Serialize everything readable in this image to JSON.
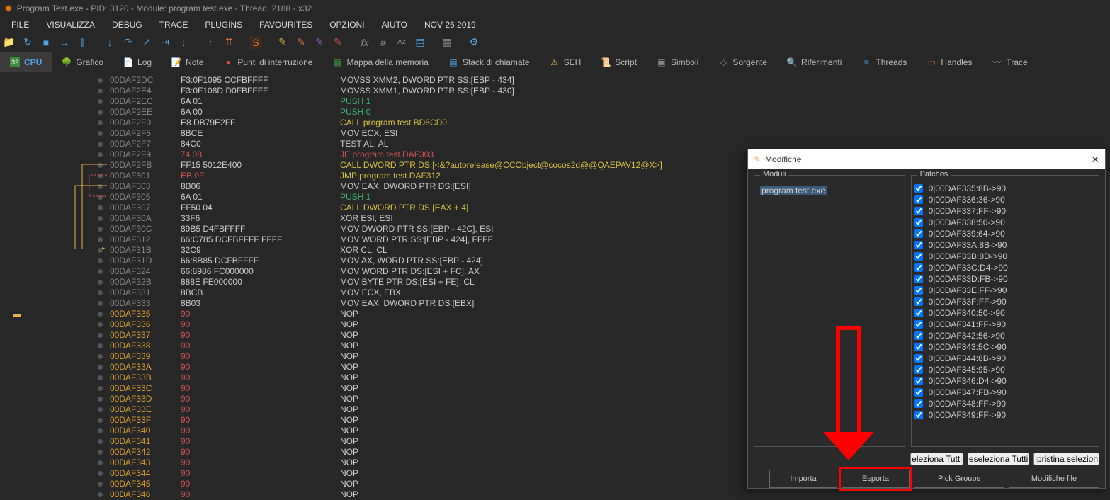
{
  "title": "Program Test.exe - PID: 3120 - Module: program test.exe - Thread: 2188 - x32",
  "menu": [
    "FILE",
    "VISUALIZZA",
    "DEBUG",
    "TRACE",
    "PLUGINS",
    "FAVOURITES",
    "OPZIONI",
    "AIUTO",
    "NOV 26 2019"
  ],
  "tabs": [
    {
      "label": "CPU",
      "active": true
    },
    {
      "label": "Grafico"
    },
    {
      "label": "Log"
    },
    {
      "label": "Note"
    },
    {
      "label": "Punti di interruzione"
    },
    {
      "label": "Mappa della memoria"
    },
    {
      "label": "Stack di chiamate"
    },
    {
      "label": "SEH"
    },
    {
      "label": "Script"
    },
    {
      "label": "Simboli"
    },
    {
      "label": "Sorgente"
    },
    {
      "label": "Riferimenti"
    },
    {
      "label": "Threads"
    },
    {
      "label": "Handles"
    },
    {
      "label": "Trace"
    }
  ],
  "disasm": [
    {
      "addr": "00DAF2DC",
      "bytes": "F3:0F1095 CCFBFFFF",
      "mn": "MOVSS XMM2, DWORD PTR SS:[EBP - 434]",
      "cls": ""
    },
    {
      "addr": "00DAF2E4",
      "bytes": "F3:0F108D D0FBFFFF",
      "mn": "MOVSS XMM1, DWORD PTR SS:[EBP - 430]",
      "cls": ""
    },
    {
      "addr": "00DAF2EC",
      "bytes": "6A 01",
      "mn": "PUSH 1",
      "cls": "green"
    },
    {
      "addr": "00DAF2EE",
      "bytes": "6A 00",
      "mn": "PUSH 0",
      "cls": "green"
    },
    {
      "addr": "00DAF2F0",
      "bytes": "E8 DB79E2FF",
      "mn": "CALL program test.BD6CD0",
      "cls": "yellow"
    },
    {
      "addr": "00DAF2F5",
      "bytes": "8BCE",
      "mn": "MOV ECX, ESI",
      "cls": ""
    },
    {
      "addr": "00DAF2F7",
      "bytes": "84C0",
      "mn": "TEST AL, AL",
      "cls": ""
    },
    {
      "addr": "00DAF2F9",
      "bytes": "74 08",
      "bred": true,
      "mn": "JE program test.DAF303",
      "cls": "red"
    },
    {
      "addr": "00DAF2FB",
      "bytes": "FF15 5012E400",
      "ul": true,
      "mn": "CALL DWORD PTR DS:[<&?autorelease@CCObject@cocos2d@@QAEPAV12@X>]",
      "cls": "yellow"
    },
    {
      "addr": "00DAF301",
      "bytes": "EB 0F",
      "bred": true,
      "mn": "JMP program test.DAF312",
      "cls": "yellow"
    },
    {
      "addr": "00DAF303",
      "bytes": "8B06",
      "mn": "MOV EAX, DWORD PTR DS:[ESI]",
      "cls": ""
    },
    {
      "addr": "00DAF305",
      "bytes": "6A 01",
      "mn": "PUSH 1",
      "cls": "green"
    },
    {
      "addr": "00DAF307",
      "bytes": "FF50 04",
      "mn": "CALL DWORD PTR DS:[EAX + 4]",
      "cls": "yellow"
    },
    {
      "addr": "00DAF30A",
      "bytes": "33F6",
      "mn": "XOR ESI, ESI",
      "cls": ""
    },
    {
      "addr": "00DAF30C",
      "bytes": "89B5 D4FBFFFF",
      "mn": "MOV DWORD PTR SS:[EBP - 42C], ESI",
      "cls": ""
    },
    {
      "addr": "00DAF312",
      "bytes": "66:C785 DCFBFFFF FFFF",
      "mn": "MOV WORD PTR SS:[EBP - 424], FFFF",
      "cls": ""
    },
    {
      "addr": "00DAF31B",
      "bytes": "32C9",
      "mn": "XOR CL, CL",
      "cls": ""
    },
    {
      "addr": "00DAF31D",
      "bytes": "66:8B85 DCFBFFFF",
      "mn": "MOV AX, WORD PTR SS:[EBP - 424]",
      "cls": ""
    },
    {
      "addr": "00DAF324",
      "bytes": "66:8986 FC000000",
      "mn": "MOV WORD PTR DS:[ESI + FC], AX",
      "cls": ""
    },
    {
      "addr": "00DAF32B",
      "bytes": "888E FE000000",
      "mn": "MOV BYTE PTR DS:[ESI + FE], CL",
      "cls": ""
    },
    {
      "addr": "00DAF331",
      "bytes": "8BCB",
      "mn": "MOV ECX, EBX",
      "cls": ""
    },
    {
      "addr": "00DAF333",
      "bytes": "8B03",
      "mn": "MOV EAX, DWORD PTR DS:[EBX]",
      "cls": ""
    },
    {
      "addr": "00DAF335",
      "hi": true,
      "bytes": "90",
      "bred": true,
      "mn": "NOP",
      "cls": "",
      "bp": true
    },
    {
      "addr": "00DAF336",
      "hi": true,
      "bytes": "90",
      "bred": true,
      "mn": "NOP",
      "cls": ""
    },
    {
      "addr": "00DAF337",
      "hi": true,
      "bytes": "90",
      "bred": true,
      "mn": "NOP",
      "cls": ""
    },
    {
      "addr": "00DAF338",
      "hi": true,
      "bytes": "90",
      "bred": true,
      "mn": "NOP",
      "cls": ""
    },
    {
      "addr": "00DAF339",
      "hi": true,
      "bytes": "90",
      "bred": true,
      "mn": "NOP",
      "cls": ""
    },
    {
      "addr": "00DAF33A",
      "hi": true,
      "bytes": "90",
      "bred": true,
      "mn": "NOP",
      "cls": ""
    },
    {
      "addr": "00DAF33B",
      "hi": true,
      "bytes": "90",
      "bred": true,
      "mn": "NOP",
      "cls": ""
    },
    {
      "addr": "00DAF33C",
      "hi": true,
      "bytes": "90",
      "bred": true,
      "mn": "NOP",
      "cls": ""
    },
    {
      "addr": "00DAF33D",
      "hi": true,
      "bytes": "90",
      "bred": true,
      "mn": "NOP",
      "cls": ""
    },
    {
      "addr": "00DAF33E",
      "hi": true,
      "bytes": "90",
      "bred": true,
      "mn": "NOP",
      "cls": ""
    },
    {
      "addr": "00DAF33F",
      "hi": true,
      "bytes": "90",
      "bred": true,
      "mn": "NOP",
      "cls": ""
    },
    {
      "addr": "00DAF340",
      "hi": true,
      "bytes": "90",
      "bred": true,
      "mn": "NOP",
      "cls": ""
    },
    {
      "addr": "00DAF341",
      "hi": true,
      "bytes": "90",
      "bred": true,
      "mn": "NOP",
      "cls": ""
    },
    {
      "addr": "00DAF342",
      "hi": true,
      "bytes": "90",
      "bred": true,
      "mn": "NOP",
      "cls": ""
    },
    {
      "addr": "00DAF343",
      "hi": true,
      "bytes": "90",
      "bred": true,
      "mn": "NOP",
      "cls": ""
    },
    {
      "addr": "00DAF344",
      "hi": true,
      "bytes": "90",
      "bred": true,
      "mn": "NOP",
      "cls": ""
    },
    {
      "addr": "00DAF345",
      "hi": true,
      "bytes": "90",
      "bred": true,
      "mn": "NOP",
      "cls": ""
    },
    {
      "addr": "00DAF346",
      "hi": true,
      "bytes": "90",
      "bred": true,
      "mn": "NOP",
      "cls": ""
    }
  ],
  "modal": {
    "title": "Modifiche",
    "moduli_title": "Moduli",
    "patches_title": "Patches",
    "module": "program test.exe",
    "patches": [
      "0|00DAF335:8B->90",
      "0|00DAF336:36->90",
      "0|00DAF337:FF->90",
      "0|00DAF338:50->90",
      "0|00DAF339:64->90",
      "0|00DAF33A:8B->90",
      "0|00DAF33B:8D->90",
      "0|00DAF33C:D4->90",
      "0|00DAF33D:FB->90",
      "0|00DAF33E:FF->90",
      "0|00DAF33F:FF->90",
      "0|00DAF340:50->90",
      "0|00DAF341:FF->90",
      "0|00DAF342:56->90",
      "0|00DAF343:5C->90",
      "0|00DAF344:8B->90",
      "0|00DAF345:95->90",
      "0|00DAF346:D4->90",
      "0|00DAF347:FB->90",
      "0|00DAF348:FF->90",
      "0|00DAF349:FF->90"
    ],
    "btn_seleziona": "eleziona Tutti",
    "btn_deseleziona": "eseleziona Tutti",
    "btn_ripristina": "ipristina selezion",
    "btn_importa": "Importa",
    "btn_esporta": "Esporta",
    "btn_pick": "Pick Groups",
    "btn_modfile": "Modifiche file"
  }
}
